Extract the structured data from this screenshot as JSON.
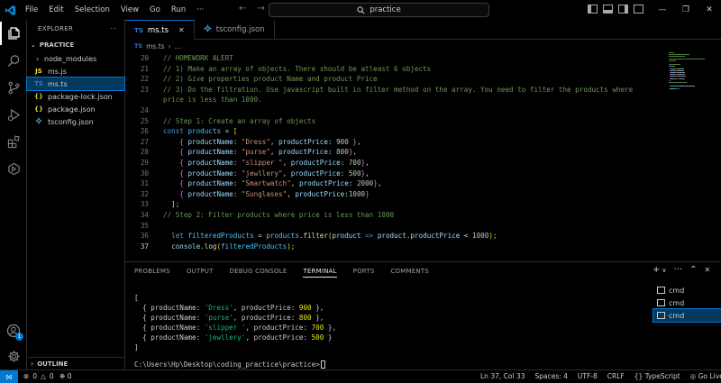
{
  "titlebar": {
    "menu": [
      "File",
      "Edit",
      "Selection",
      "View",
      "Go",
      "Run"
    ],
    "more": "···",
    "search_text": "practice"
  },
  "sidebar": {
    "header": "EXPLORER",
    "more": "···",
    "folder": "PRACTICE",
    "items": [
      {
        "label": "node_modules",
        "kind": "folder"
      },
      {
        "label": "ms.js",
        "kind": "js",
        "icon_text": "JS"
      },
      {
        "label": "ms.ts",
        "kind": "ts",
        "icon_text": "TS",
        "selected": true
      },
      {
        "label": "package-lock.json",
        "kind": "json",
        "icon_text": "{}"
      },
      {
        "label": "package.json",
        "kind": "json",
        "icon_text": "{}"
      },
      {
        "label": "tsconfig.json",
        "kind": "tsconfig"
      }
    ],
    "outline": "OUTLINE"
  },
  "tabs": [
    {
      "label": "ms.ts",
      "icon_text": "TS",
      "active": true
    },
    {
      "label": "tsconfig.json",
      "active": false
    }
  ],
  "breadcrumb": {
    "file": "ms.ts",
    "icon_text": "TS",
    "rest": "…"
  },
  "editor": {
    "lines": [
      {
        "n": "20",
        "tokens": [
          [
            "com",
            "// HOMEWORK ALERT"
          ]
        ]
      },
      {
        "n": "21",
        "tokens": [
          [
            "com",
            "// 1) Make an array of objects. There should be atleast 6 objects"
          ]
        ]
      },
      {
        "n": "22",
        "tokens": [
          [
            "com",
            "// 2) Give properties product Name and product Price"
          ]
        ]
      },
      {
        "n": "23",
        "tokens": [
          [
            "com",
            "// 3) Do the filtration. Use javascript built in filter method on the array. You need to filter the products where"
          ]
        ]
      },
      {
        "n": "",
        "tokens": [
          [
            "com",
            "price is less than 1000."
          ]
        ]
      },
      {
        "n": "24",
        "tokens": []
      },
      {
        "n": "25",
        "tokens": [
          [
            "com",
            "// Step 1: Create an array of objects"
          ]
        ]
      },
      {
        "n": "26",
        "tokens": [
          [
            "kw",
            "const"
          ],
          [
            "def",
            " "
          ],
          [
            "var",
            "products"
          ],
          [
            "def",
            " = "
          ],
          [
            "p1",
            "["
          ]
        ]
      },
      {
        "n": "27",
        "tokens": [
          [
            "def",
            "    "
          ],
          [
            "p2",
            "{"
          ],
          [
            "def",
            " "
          ],
          [
            "prop",
            "productName"
          ],
          [
            "def",
            ": "
          ],
          [
            "str",
            "\"Dress\""
          ],
          [
            "def",
            ", "
          ],
          [
            "prop",
            "productPrice"
          ],
          [
            "def",
            ": "
          ],
          [
            "num",
            "900"
          ],
          [
            "def",
            " "
          ],
          [
            "p2",
            "}"
          ],
          [
            "def",
            ","
          ]
        ]
      },
      {
        "n": "28",
        "tokens": [
          [
            "def",
            "    "
          ],
          [
            "p2",
            "{"
          ],
          [
            "def",
            " "
          ],
          [
            "prop",
            "productName"
          ],
          [
            "def",
            ": "
          ],
          [
            "str",
            "\"purse\""
          ],
          [
            "def",
            ", "
          ],
          [
            "prop",
            "productPrice"
          ],
          [
            "def",
            ": "
          ],
          [
            "num",
            "800"
          ],
          [
            "p2",
            "}"
          ],
          [
            "def",
            ","
          ]
        ]
      },
      {
        "n": "29",
        "tokens": [
          [
            "def",
            "    "
          ],
          [
            "p2",
            "{"
          ],
          [
            "def",
            " "
          ],
          [
            "prop",
            "productName"
          ],
          [
            "def",
            ": "
          ],
          [
            "str",
            "\"slipper \""
          ],
          [
            "def",
            ", "
          ],
          [
            "prop",
            "productPrice"
          ],
          [
            "def",
            ": "
          ],
          [
            "num",
            "700"
          ],
          [
            "p2",
            "}"
          ],
          [
            "def",
            ","
          ]
        ]
      },
      {
        "n": "30",
        "tokens": [
          [
            "def",
            "    "
          ],
          [
            "p2",
            "{"
          ],
          [
            "def",
            " "
          ],
          [
            "prop",
            "productName"
          ],
          [
            "def",
            ": "
          ],
          [
            "str",
            "\"jewllery\""
          ],
          [
            "def",
            ", "
          ],
          [
            "prop",
            "productPrice"
          ],
          [
            "def",
            ": "
          ],
          [
            "num",
            "500"
          ],
          [
            "p2",
            "}"
          ],
          [
            "def",
            ","
          ]
        ]
      },
      {
        "n": "31",
        "tokens": [
          [
            "def",
            "    "
          ],
          [
            "p2",
            "{"
          ],
          [
            "def",
            " "
          ],
          [
            "prop",
            "productName"
          ],
          [
            "def",
            ": "
          ],
          [
            "str",
            "\"Smartwatch\""
          ],
          [
            "def",
            ", "
          ],
          [
            "prop",
            "productPrice"
          ],
          [
            "def",
            ": "
          ],
          [
            "num",
            "2000"
          ],
          [
            "p2",
            "}"
          ],
          [
            "def",
            ","
          ]
        ]
      },
      {
        "n": "32",
        "tokens": [
          [
            "def",
            "    "
          ],
          [
            "p2",
            "{"
          ],
          [
            "def",
            " "
          ],
          [
            "prop",
            "productName"
          ],
          [
            "def",
            ": "
          ],
          [
            "str",
            "\"Sunglases\""
          ],
          [
            "def",
            ", "
          ],
          [
            "prop",
            "productPrice"
          ],
          [
            "def",
            ":"
          ],
          [
            "num",
            "1000"
          ],
          [
            "p2",
            "}"
          ]
        ]
      },
      {
        "n": "33",
        "tokens": [
          [
            "def",
            "  "
          ],
          [
            "p1",
            "]"
          ],
          [
            "def",
            ";"
          ]
        ]
      },
      {
        "n": "34",
        "tokens": [
          [
            "com",
            "// Step 2: Filter products where price is less than 1000"
          ]
        ]
      },
      {
        "n": "35",
        "tokens": []
      },
      {
        "n": "36",
        "tokens": [
          [
            "def",
            "  "
          ],
          [
            "kw",
            "let"
          ],
          [
            "def",
            " "
          ],
          [
            "var",
            "filteredProducts"
          ],
          [
            "def",
            " = "
          ],
          [
            "var",
            "products"
          ],
          [
            "def",
            "."
          ],
          [
            "fn",
            "filter"
          ],
          [
            "p1",
            "("
          ],
          [
            "prop",
            "product"
          ],
          [
            "def",
            " "
          ],
          [
            "kw",
            "=>"
          ],
          [
            "def",
            " "
          ],
          [
            "prop",
            "product"
          ],
          [
            "def",
            "."
          ],
          [
            "prop",
            "productPrice"
          ],
          [
            "def",
            " < "
          ],
          [
            "num",
            "1000"
          ],
          [
            "p1",
            ")"
          ],
          [
            "def",
            ";"
          ]
        ]
      },
      {
        "n": "37",
        "current": true,
        "tokens": [
          [
            "def",
            "  "
          ],
          [
            "prop",
            "console"
          ],
          [
            "def",
            "."
          ],
          [
            "fn",
            "log"
          ],
          [
            "p1",
            "("
          ],
          [
            "var",
            "filteredProducts"
          ],
          [
            "p1",
            ")"
          ],
          [
            "def",
            ";"
          ]
        ]
      }
    ]
  },
  "panel": {
    "tabs": [
      "PROBLEMS",
      "OUTPUT",
      "DEBUG CONSOLE",
      "TERMINAL",
      "PORTS",
      "COMMENTS"
    ],
    "active_tab": "TERMINAL",
    "actions": [
      "+",
      "∨",
      "···",
      "⌃",
      "✕"
    ],
    "terminal_lines": [
      [
        [
          "def",
          "["
        ]
      ],
      [
        [
          "def",
          "  { productName: "
        ],
        [
          "str",
          "'Dress'"
        ],
        [
          "def",
          ", productPrice: "
        ],
        [
          "num",
          "900"
        ],
        [
          "def",
          " },"
        ]
      ],
      [
        [
          "def",
          "  { productName: "
        ],
        [
          "str",
          "'purse'"
        ],
        [
          "def",
          ", productPrice: "
        ],
        [
          "num",
          "800"
        ],
        [
          "def",
          " },"
        ]
      ],
      [
        [
          "def",
          "  { productName: "
        ],
        [
          "str",
          "'slipper '"
        ],
        [
          "def",
          ", productPrice: "
        ],
        [
          "num",
          "700"
        ],
        [
          "def",
          " },"
        ]
      ],
      [
        [
          "def",
          "  { productName: "
        ],
        [
          "str",
          "'jewllery'"
        ],
        [
          "def",
          ", productPrice: "
        ],
        [
          "num",
          "500"
        ],
        [
          "def",
          " }"
        ]
      ],
      [
        [
          "def",
          "]"
        ]
      ]
    ],
    "prompt": "C:\\Users\\Hp\\Desktop\\coding_practice\\practice>",
    "terminal_instances": [
      {
        "label": "cmd",
        "active": false
      },
      {
        "label": "cmd",
        "active": false
      },
      {
        "label": "cmd",
        "active": true
      }
    ]
  },
  "statusbar": {
    "remote_glyph": "⨝",
    "errors": "0",
    "warnings": "0",
    "ports": "0",
    "position": "Ln 37, Col 33",
    "spaces": "Spaces: 4",
    "encoding": "UTF-8",
    "eol": "CRLF",
    "language": "TypeScript",
    "language_braces": "{}",
    "golive": "Go Live"
  },
  "accounts_badge": "1",
  "colors": {
    "accent": "#0078d4",
    "comment": "#6a9955",
    "keyword": "#569cd6",
    "string": "#ce9178",
    "number": "#b5cea8"
  }
}
